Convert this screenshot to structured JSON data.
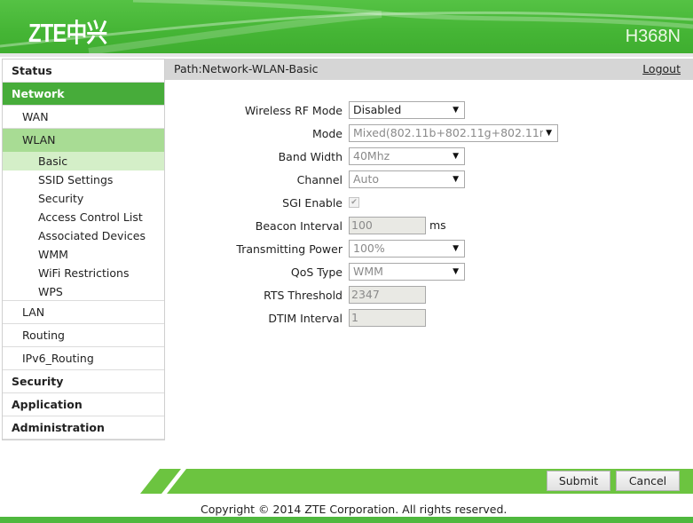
{
  "header": {
    "logo": "ZTE中兴",
    "model": "H368N"
  },
  "path": {
    "text": "Path:Network-WLAN-Basic",
    "logout": "Logout"
  },
  "sidebar": {
    "status": "Status",
    "network": "Network",
    "network_items": {
      "wan": "WAN",
      "wlan": "WLAN",
      "wlan_items": [
        "Basic",
        "SSID Settings",
        "Security",
        "Access Control List",
        "Associated Devices",
        "WMM",
        "WiFi Restrictions",
        "WPS"
      ],
      "lan": "LAN",
      "routing": "Routing",
      "ipv6_routing": "IPv6_Routing"
    },
    "security": "Security",
    "application": "Application",
    "administration": "Administration"
  },
  "form": {
    "wireless_rf_mode": {
      "label": "Wireless RF Mode",
      "value": "Disabled"
    },
    "mode": {
      "label": "Mode",
      "value": "Mixed(802.11b+802.11g+802.11r"
    },
    "band_width": {
      "label": "Band Width",
      "value": "40Mhz"
    },
    "channel": {
      "label": "Channel",
      "value": "Auto"
    },
    "sgi_enable": {
      "label": "SGI Enable",
      "checked": true,
      "mark": "✔"
    },
    "beacon_interval": {
      "label": "Beacon Interval",
      "value": "100",
      "unit": "ms"
    },
    "transmitting_power": {
      "label": "Transmitting Power",
      "value": "100%"
    },
    "qos_type": {
      "label": "QoS Type",
      "value": "WMM"
    },
    "rts_threshold": {
      "label": "RTS Threshold",
      "value": "2347"
    },
    "dtim_interval": {
      "label": "DTIM Interval",
      "value": "1"
    }
  },
  "buttons": {
    "submit": "Submit",
    "cancel": "Cancel"
  },
  "footer": {
    "copyright": "Copyright © 2014 ZTE Corporation. All rights reserved."
  },
  "icons": {
    "dropdown_arrow": "▼"
  },
  "colors": {
    "brand_green": "#45b535",
    "active_nav": "#47ac3a",
    "wlan_highlight": "#a8dc94"
  }
}
